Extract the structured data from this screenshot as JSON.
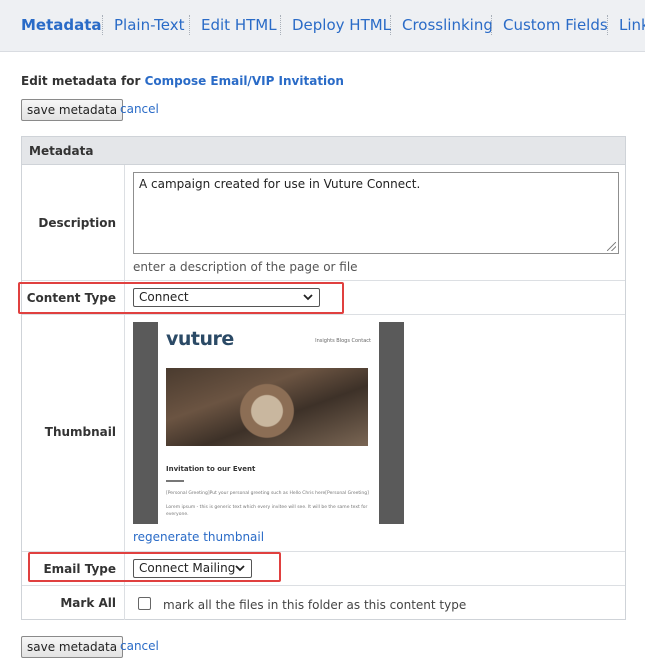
{
  "tabs": [
    {
      "label": "Metadata",
      "active": true
    },
    {
      "label": "Plain-Text"
    },
    {
      "label": "Edit HTML"
    },
    {
      "label": "Deploy HTML"
    },
    {
      "label": "Crosslinking"
    },
    {
      "label": "Custom Fields"
    },
    {
      "label": "Link"
    }
  ],
  "heading": {
    "prefix": "Edit metadata for",
    "page_link": "Compose Email/VIP Invitation"
  },
  "actions": {
    "save_label": "save metadata",
    "cancel_label": "cancel"
  },
  "panel": {
    "title": "Metadata",
    "description": {
      "label": "Description",
      "value": "A campaign created for use in Vuture Connect.",
      "hint": "enter a description of the page or file"
    },
    "content_type": {
      "label": "Content Type",
      "selected": "Connect"
    },
    "thumbnail": {
      "label": "Thumbnail",
      "regenerate_label": "regenerate thumbnail",
      "preview": {
        "logo": "vuture",
        "nav": "Insights   Blogs   Contact",
        "title": "Invitation to our Event",
        "line1": "[Personal Greeting]Put your personal greeting such as Hello Chris here[Personal Greeting]",
        "line2": "Lorem ipsum - this is generic text which every invitee will see.  It will be the same text for",
        "line3": "everyone."
      }
    },
    "email_type": {
      "label": "Email Type",
      "selected": "Connect Mailing"
    },
    "mark_all": {
      "label": "Mark All",
      "checked": false,
      "text": "mark all the files in this folder as this content type"
    }
  },
  "colors": {
    "link": "#2a6bc7",
    "highlight": "#e0403f",
    "header_bg": "#e4e6e9"
  }
}
